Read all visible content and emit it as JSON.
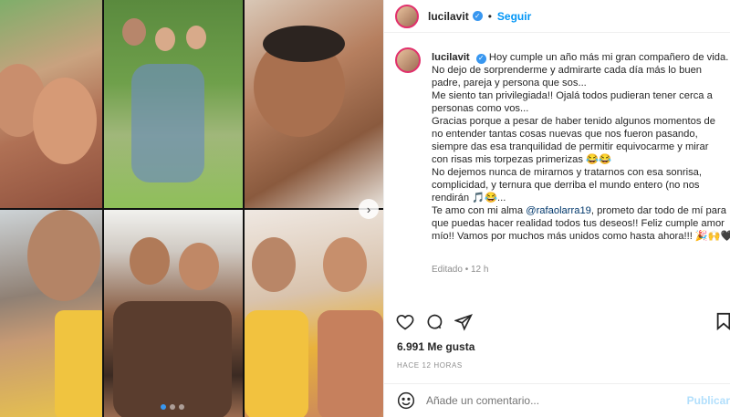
{
  "post": {
    "username": "lucilavit",
    "follow_label": "Seguir",
    "separator": "•",
    "caption_lines": [
      "Hoy cumple un año más mi gran compañero de vida.",
      "No dejo de sorprenderme y admirarte cada día más lo buen",
      "padre, pareja y persona que sos...",
      "Me siento tan privilegiada!! Ojalá todos pudieran tener cerca a",
      "personas como vos...",
      "Gracias porque a pesar de haber tenido algunos momentos de",
      "no entender tantas cosas nuevas que nos fueron pasando,",
      "siempre das esa tranquilidad de permitir equivocarme y mirar",
      "con risas mis torpezas primerizas 😂😂",
      "No dejemos nunca de mirarnos y tratarnos con esa sonrisa,",
      "complicidad, y ternura que derriba el mundo entero (no nos",
      "rendirán 🎵😂...",
      "Te amo con mi alma",
      "que puedas hacer realidad todos tus deseos!! Feliz cumple amor",
      "mío!! Vamos por muchos más unidos como hasta ahora!!! 🎉🙌🖤"
    ],
    "mention": "@rafaolarra19",
    "mention_suffix": ", prometo dar todo de mí para",
    "edited_label": "Editado",
    "edited_time": "12 h",
    "likes": "6.991 Me gusta",
    "time_ago": "HACE 12 HORAS",
    "comment_placeholder": "Añade un comentario...",
    "publish_label": "Publicar"
  },
  "icons": [
    "heart-icon",
    "comment-icon",
    "share-icon",
    "bookmark-icon",
    "emoji-icon",
    "verified-icon",
    "carousel-next-icon"
  ],
  "colors": {
    "accent": "#0095f6",
    "verified": "#3897f0",
    "text": "#262626",
    "muted": "#8e8e8e"
  },
  "carousel": {
    "count": 3,
    "active": 1
  }
}
